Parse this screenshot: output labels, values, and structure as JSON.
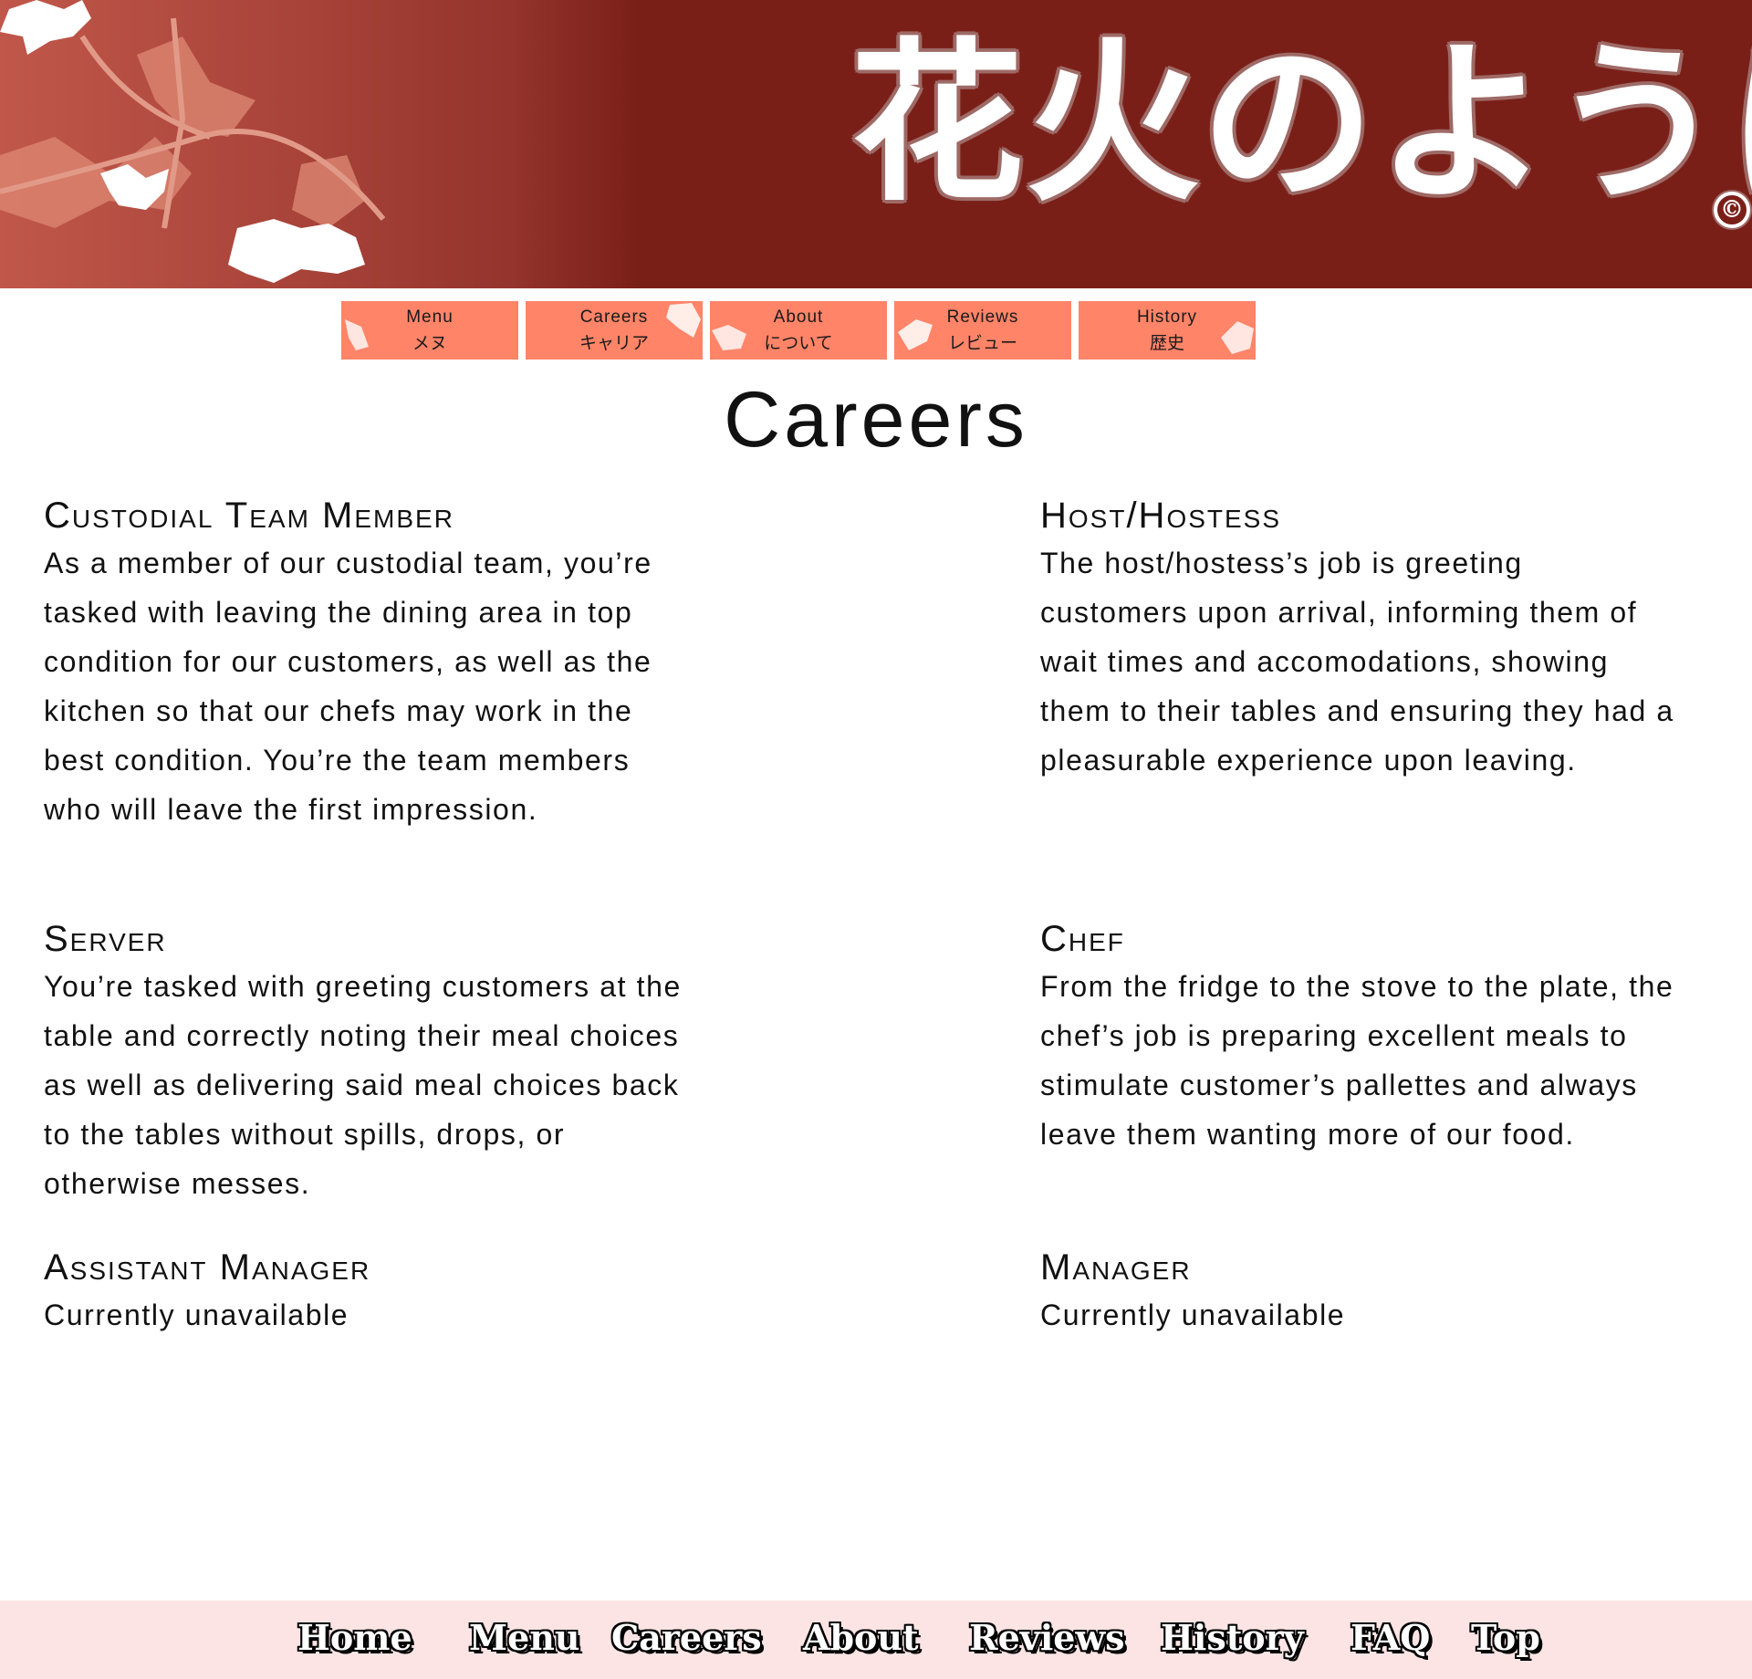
{
  "banner": {
    "logo_text": "花火のように",
    "copyright_symbol": "©",
    "colors": {
      "background": "#7a1f18",
      "left_fade": "#c0574a",
      "logo_outline": "#9e6a66"
    }
  },
  "top_nav": {
    "tile_color": "#ff8468",
    "items": [
      {
        "en": "Menu",
        "jp": "メヌ"
      },
      {
        "en": "Careers",
        "jp": "キャリア"
      },
      {
        "en": "About",
        "jp": "について"
      },
      {
        "en": "Reviews",
        "jp": "レビュー"
      },
      {
        "en": "History",
        "jp": "歴史"
      }
    ]
  },
  "page": {
    "title": "Careers"
  },
  "jobs": [
    {
      "title": "Custodial Team Member",
      "description": "As a member of our custodial team, you’re tasked with leaving the dining area in top condition for our customers, as well as the kitchen so that our chefs may work in the best condition. You’re the team members who will leave the first impression."
    },
    {
      "title": "Host/Hostess",
      "description": "The host/hostess’s job is greeting customers upon arrival, informing them of wait times and accomodations, showing them to their tables and ensuring they had a pleasurable experience upon leaving."
    },
    {
      "title": "Server",
      "description": "You’re tasked with greeting customers at the table and correctly noting their meal choices as well as delivering said meal choices back to the tables without spills, drops, or otherwise messes."
    },
    {
      "title": "Chef",
      "description": "From the fridge to the stove to the plate, the chef’s job is preparing excellent meals to stimulate customer’s pallettes and always leave them wanting more of our food."
    },
    {
      "title": "Assistant Manager",
      "description": "Currently unavailable"
    },
    {
      "title": "Manager",
      "description": "Currently unavailable"
    }
  ],
  "footer": {
    "background": "#fde4e4",
    "links": [
      "Home",
      "Menu",
      "Careers",
      "About",
      "Reviews",
      "History",
      "FAQ",
      "Top"
    ]
  }
}
